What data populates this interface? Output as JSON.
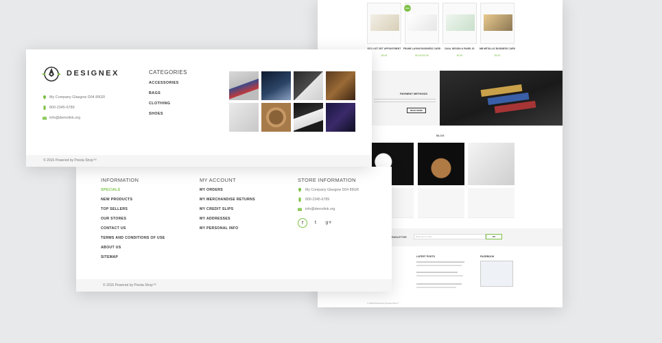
{
  "colors": {
    "accent": "#7bc043",
    "background": "#e7e9eb",
    "text_dark": "#333333",
    "text_muted": "#777777"
  },
  "right_page": {
    "sale_badge": "NEW",
    "products": [
      {
        "name": "ECO LIST SET APPOINTMENT",
        "price": "$9.45"
      },
      {
        "name": "FRAME LAYING BUSINESS CARD",
        "price": "$9.45 $10.50"
      },
      {
        "name": "DUAL DESIGN & PANEL ID",
        "price": "$9.45"
      },
      {
        "name": "MB METALLIC BUSINESS CARD",
        "price": "$9.45"
      }
    ],
    "payment": {
      "title": "PAYMENT METHODS",
      "button": "READ MORE"
    },
    "blog_title": "BLOG",
    "newsletter": {
      "label": "NEWSLETTER",
      "placeholder": "Enter your e-mail",
      "button": "OK"
    },
    "columns": {
      "latest_posts": "LATEST POSTS",
      "facebook": "FACEBOOK"
    },
    "copyright": "© 2016 Powered by Presta Shop™"
  },
  "footer": {
    "information": {
      "title": "INFORMATION",
      "links": [
        "SPECIALS",
        "NEW PRODUCTS",
        "TOP SELLERS",
        "OUR STORES",
        "CONTACT US",
        "TERMS AND CONDITIONS OF USE",
        "ABOUT US",
        "SITEMAP"
      ]
    },
    "my_account": {
      "title": "MY ACCOUNT",
      "links": [
        "MY ORDERS",
        "MY MERCHANDISE RETURNS",
        "MY CREDIT SLIPS",
        "MY ADDRESSES",
        "MY PERSONAL INFO"
      ]
    },
    "store": {
      "title": "STORE INFORMATION",
      "address": "My Company Glasgow D04 89GR",
      "phone": "800-2345-6789",
      "email": "info@demolink.org",
      "social": [
        "f",
        "t",
        "g+"
      ]
    },
    "copyright": "© 2016 Powered by Presta Shop™"
  },
  "designex": {
    "logo": "DESIGNEX",
    "address": "My Company Glasgow D04 89GR",
    "phone": "800-2345-6789",
    "email": "info@demolink.org",
    "categories": {
      "title": "CATEGORIES",
      "links": [
        "ACCESSORIES",
        "BAGS",
        "CLOTHING",
        "SHOES"
      ]
    },
    "copyright": "© 2016 Powered by Presta Shop™"
  }
}
